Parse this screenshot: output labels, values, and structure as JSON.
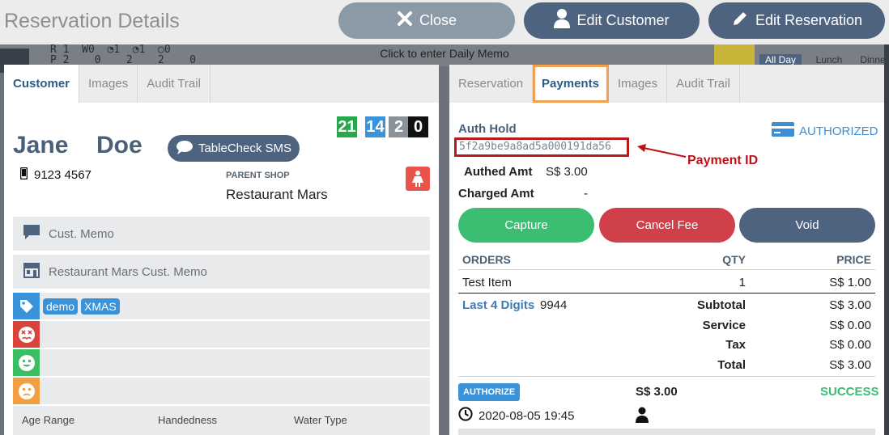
{
  "background": {
    "count_rows": "R 1  W0  ◔1  ◔1  ○0\nP 2    0    2    2    0",
    "memo_prompt": "Click to enter Daily Memo",
    "chips": [
      "All Day",
      "Lunch",
      "Dinne"
    ]
  },
  "header": {
    "title": "Reservation Details",
    "close_label": "Close",
    "edit_customer_label": "Edit Customer",
    "edit_reservation_label": "Edit Reservation"
  },
  "customer_panel": {
    "tabs": [
      "Customer",
      "Images",
      "Audit Trail"
    ],
    "scores": [
      {
        "value": "21",
        "color": "#27a84a"
      },
      {
        "value": "14",
        "color": "#3a92d8"
      },
      {
        "value": "2",
        "color": "#8a9199"
      },
      {
        "value": "0",
        "color": "#111111"
      }
    ],
    "first_name": "Jane",
    "last_name": "Doe",
    "sms_label": "TableCheck SMS",
    "phone": "9123 4567",
    "parent_shop_label": "PARENT SHOP",
    "parent_shop_value": "Restaurant Mars",
    "cust_memo_placeholder": "Cust. Memo",
    "shop_memo_placeholder": "Restaurant Mars Cust. Memo",
    "tags": [
      "demo",
      "XMAS"
    ],
    "meta_labels": [
      "Age Range",
      "Handedness",
      "Water Type"
    ]
  },
  "payment_panel": {
    "tabs": [
      "Reservation",
      "Payments",
      "Images",
      "Audit Trail"
    ],
    "auth_hold_label": "Auth Hold",
    "status": "AUTHORIZED",
    "payment_id": "5f2a9be9a8ad5a000191da56",
    "annotation": "Payment ID",
    "authed_amt_label": "Authed Amt",
    "authed_amt_value": "S$ 3.00",
    "charged_amt_label": "Charged Amt",
    "charged_amt_value": "-",
    "capture_label": "Capture",
    "cancel_fee_label": "Cancel Fee",
    "void_label": "Void",
    "orders_header": "ORDERS",
    "qty_header": "QTY",
    "price_header": "PRICE",
    "item_name": "Test Item",
    "item_qty": "1",
    "item_price": "S$ 1.00",
    "last4_label": "Last 4 Digits",
    "last4_value": "9944",
    "subtotal_label": "Subtotal",
    "subtotal_value": "S$ 3.00",
    "service_label": "Service",
    "service_value": "S$ 0.00",
    "tax_label": "Tax",
    "tax_value": "S$ 0.00",
    "total_label": "Total",
    "total_value": "S$ 3.00",
    "txn_type": "AUTHORIZE",
    "txn_amount": "S$ 3.00",
    "txn_result": "SUCCESS",
    "txn_time": "2020-08-05 19:45"
  }
}
